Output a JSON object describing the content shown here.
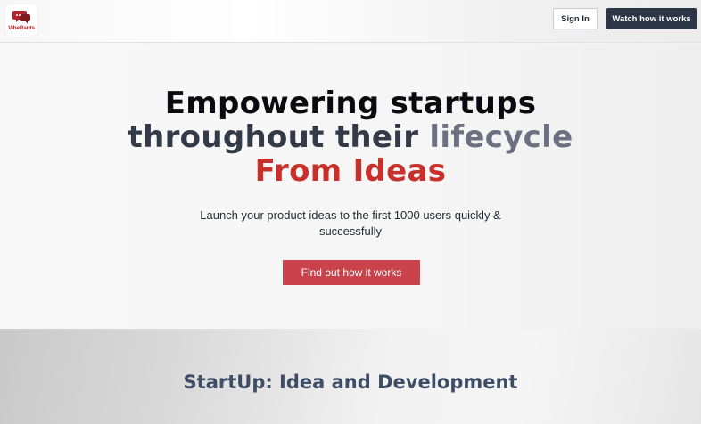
{
  "header": {
    "logo_text": "VibeRants",
    "sign_in_label": "Sign In",
    "watch_label": "Watch how it works"
  },
  "hero": {
    "headline_line1": "Empowering startups",
    "headline_line2a": "throughout their",
    "headline_line2b": "lifecycle",
    "headline_line3": "From Ideas",
    "subtext": "Launch your product ideas to the first 1000 users quickly & successfully",
    "cta_label": "Find out how it works"
  },
  "section2": {
    "title": "StartUp: Idea and Development"
  },
  "colors": {
    "brand_red": "#c8302b",
    "cta_red": "#c9424c",
    "dark_button": "#2d3646",
    "heading_dark": "#0b0b0f",
    "heading_gray": "#6b7180",
    "section_title": "#3d4d66"
  },
  "icons": {
    "logo": "speech-bubble-logo-icon"
  }
}
